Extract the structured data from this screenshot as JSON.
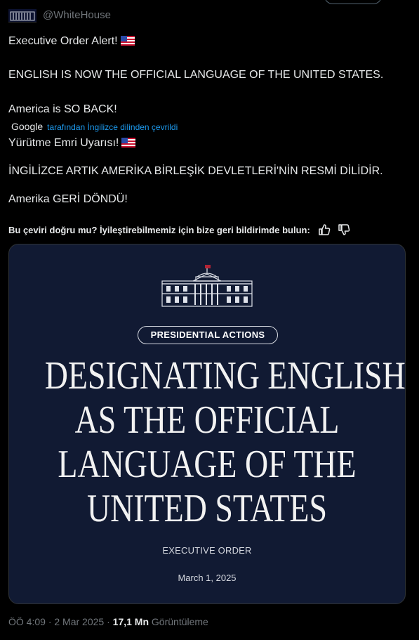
{
  "header": {
    "handle": "@WhiteHouse"
  },
  "tweet": {
    "original": {
      "line1": "Executive Order Alert!",
      "line2": "ENGLISH IS NOW THE OFFICIAL LANGUAGE OF THE UNITED STATES.",
      "line3": "America is SO BACK!"
    },
    "translation": {
      "provider": "Google",
      "translated_from": "tarafından İngilizce dilinden çevrildi",
      "line1": "Yürütme Emri Uyarısı!",
      "line2": "İNGİLİZCE ARTIK AMERİKA BİRLEŞİK DEVLETLERİ'NİN RESMİ DİLİDİR.",
      "line3": "Amerika GERİ DÖNDÜ!"
    },
    "feedback_prompt": "Bu çeviri doğru mu? İyileştirebilmemiz için bize geri bildirimde bulun:",
    "flag_emoji": "us-flag-icon"
  },
  "media": {
    "pill_label": "PRESIDENTIAL ACTIONS",
    "headline": [
      "DESIGNATING ENGLISH",
      "AS THE OFFICIAL",
      "LANGUAGE OF THE",
      "UNITED STATES"
    ],
    "order_type": "EXECUTIVE ORDER",
    "date": "March 1, 2025",
    "background_color": "#111a33"
  },
  "meta": {
    "time": "ÖÖ 4:09",
    "separator": "·",
    "date": "2 Mar 2025",
    "views_count": "17,1 Mn",
    "views_label": "Görüntüleme"
  },
  "colors": {
    "background": "#000000",
    "text": "#e7e9ea",
    "muted": "#71767b",
    "link": "#1d9bf0"
  }
}
